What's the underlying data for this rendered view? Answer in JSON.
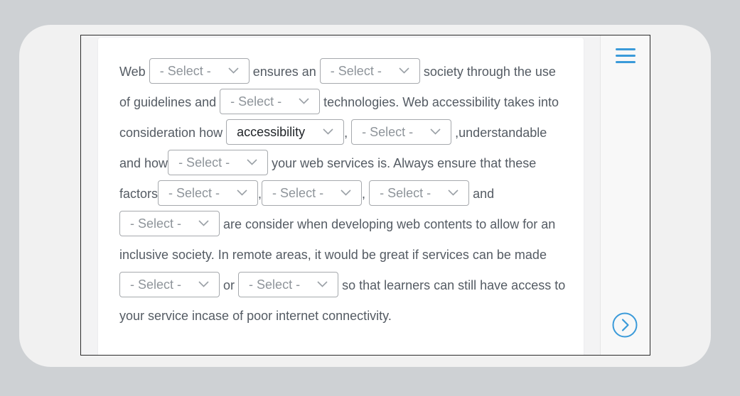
{
  "colors": {
    "accent": "#3a9ad9",
    "text": "#545b63",
    "placeholder": "#8e949a"
  },
  "passage": {
    "t1": "Web",
    "t2": "ensures an",
    "t3": "society through the use of guidelines and",
    "t4": "technologies. Web accessibility takes into consideration how",
    "t5": ",",
    "t6": ",understandable and how",
    "t7": "your web services is. Always ensure that these factors",
    "t8": ",",
    "t9": ",",
    "t10": "and",
    "t11": "are consider when developing web contents to allow for an inclusive society. In remote areas, it would be great if services can be made",
    "t12": "or",
    "t13": "so that learners can still have access to your service incase of poor internet connectivity."
  },
  "dropdowns": {
    "d1": "- Select -",
    "d2": "- Select -",
    "d3": "- Select -",
    "d4": "accessibility",
    "d5": "- Select -",
    "d6": "- Select -",
    "d7": "- Select -",
    "d8": "- Select -",
    "d9": "- Select -",
    "d10": "- Select -",
    "d11": "- Select -",
    "d12": "- Select -"
  },
  "sidebar": {
    "menu_icon": "hamburger-menu-icon",
    "next_icon": "chevron-right-circle-icon"
  }
}
